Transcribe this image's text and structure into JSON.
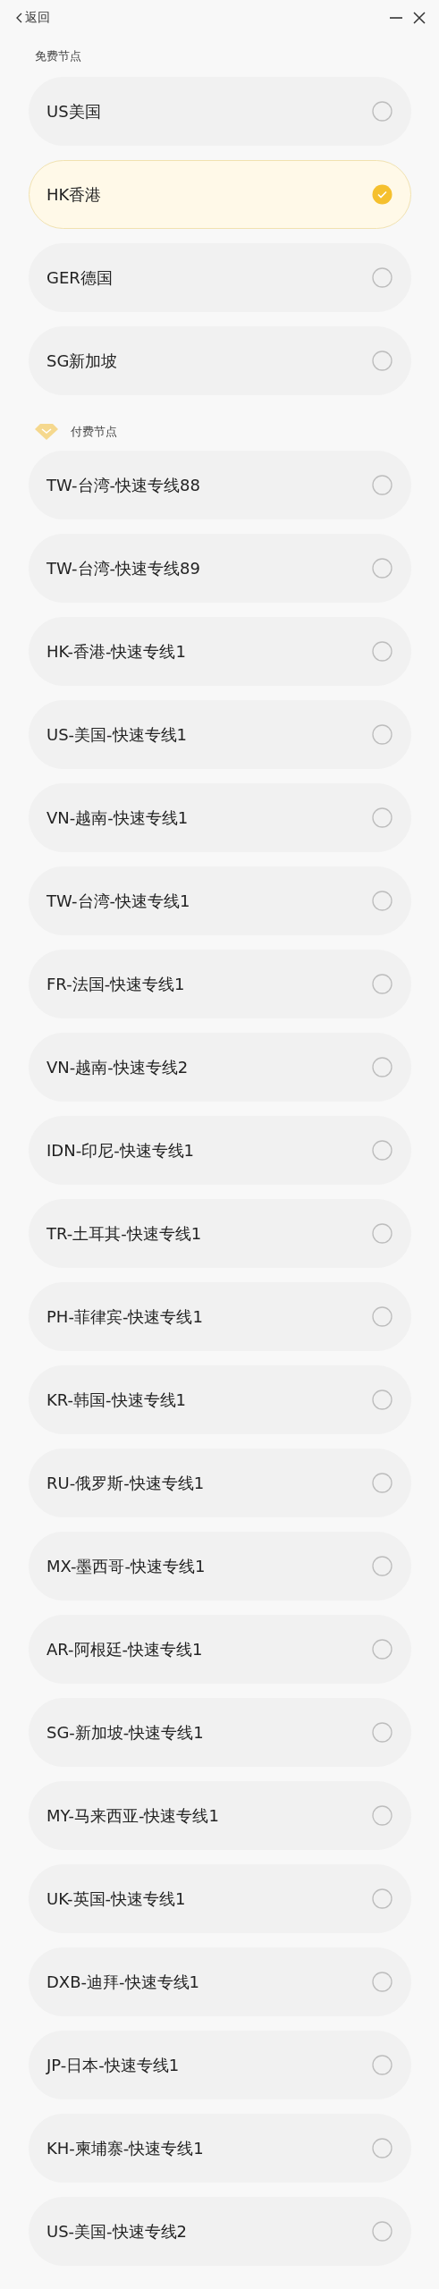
{
  "header": {
    "back_label": "返回"
  },
  "sections": [
    {
      "kind": "free",
      "title": "免费节点",
      "nodes": [
        {
          "name": "US美国",
          "selected": false
        },
        {
          "name": "HK香港",
          "selected": true
        },
        {
          "name": "GER德国",
          "selected": false
        },
        {
          "name": "SG新加坡",
          "selected": false
        }
      ]
    },
    {
      "kind": "paid",
      "title": "付费节点",
      "nodes": [
        {
          "name": "TW-台湾-快速专线88",
          "selected": false
        },
        {
          "name": "TW-台湾-快速专线89",
          "selected": false
        },
        {
          "name": "HK-香港-快速专线1",
          "selected": false
        },
        {
          "name": "US-美国-快速专线1",
          "selected": false
        },
        {
          "name": "VN-越南-快速专线1",
          "selected": false
        },
        {
          "name": "TW-台湾-快速专线1",
          "selected": false
        },
        {
          "name": "FR-法国-快速专线1",
          "selected": false
        },
        {
          "name": "VN-越南-快速专线2",
          "selected": false
        },
        {
          "name": "IDN-印尼-快速专线1",
          "selected": false
        },
        {
          "name": "TR-土耳其-快速专线1",
          "selected": false
        },
        {
          "name": "PH-菲律宾-快速专线1",
          "selected": false
        },
        {
          "name": "KR-韩国-快速专线1",
          "selected": false
        },
        {
          "name": "RU-俄罗斯-快速专线1",
          "selected": false
        },
        {
          "name": "MX-墨西哥-快速专线1",
          "selected": false
        },
        {
          "name": "AR-阿根廷-快速专线1",
          "selected": false
        },
        {
          "name": "SG-新加坡-快速专线1",
          "selected": false
        },
        {
          "name": "MY-马来西亚-快速专线1",
          "selected": false
        },
        {
          "name": "UK-英国-快速专线1",
          "selected": false
        },
        {
          "name": "DXB-迪拜-快速专线1",
          "selected": false
        },
        {
          "name": "JP-日本-快速专线1",
          "selected": false
        },
        {
          "name": "KH-柬埔寨-快速专线1",
          "selected": false
        },
        {
          "name": "US-美国-快速专线2",
          "selected": false
        }
      ]
    }
  ]
}
